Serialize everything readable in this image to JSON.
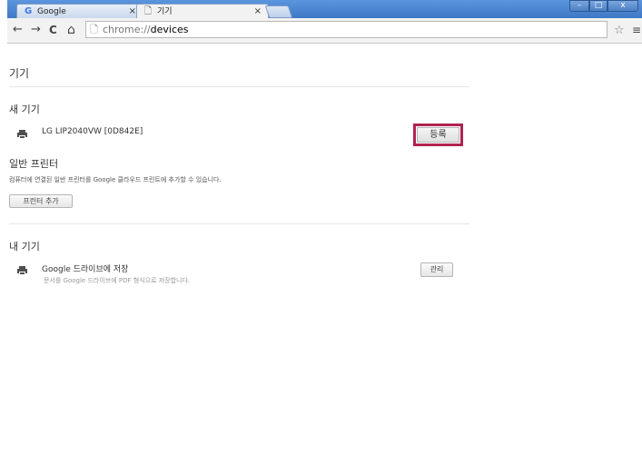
{
  "tabs": [
    {
      "favicon": "G",
      "title": "Google",
      "close": "×",
      "active": false
    },
    {
      "favicon": "🗋",
      "title": "기기",
      "close": "×",
      "active": true
    }
  ],
  "window_controls": {
    "minimize": "–",
    "maximize": "□",
    "close": "x"
  },
  "toolbar": {
    "back": "←",
    "forward": "→",
    "reload": "C",
    "home": "⌂",
    "url_host": "chrome://",
    "url_path": "devices",
    "bookmark_star": "☆",
    "menu": "≡"
  },
  "page": {
    "title": "기기",
    "new_devices": {
      "heading": "새 기기",
      "device_name": "LG LIP2040VW [0D842E]",
      "register_label": "등록"
    },
    "classic_printers": {
      "heading": "일반 프린터",
      "description": "컴퓨터에 연결된 일반 프린터를 Google 클라우드 프린트에 추가할 수 있습니다.",
      "add_button": "프린터 추가"
    },
    "my_devices": {
      "heading": "내 기기",
      "device_name": "Google 드라이브에 저장",
      "device_desc": "문서를 Google 드라이브에 PDF 형식으로 저장합니다.",
      "manage_label": "관리"
    }
  }
}
